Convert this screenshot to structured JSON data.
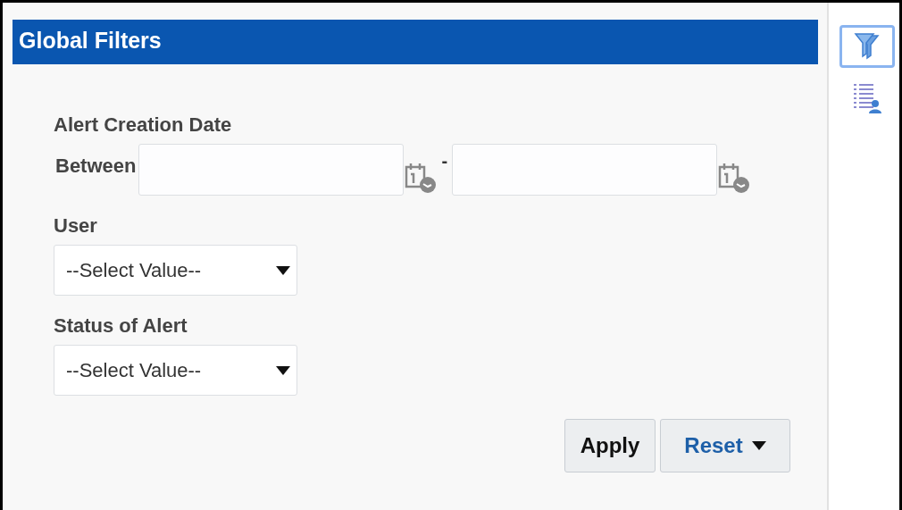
{
  "panel": {
    "title": "Global Filters"
  },
  "filters": [
    {
      "kind": "date_range",
      "label": "Alert Creation Date",
      "prefix": "Between",
      "separator": "-"
    },
    {
      "kind": "select",
      "label": "User",
      "value": "--Select Value--"
    },
    {
      "kind": "select",
      "label": "Status of Alert",
      "value": "--Select Value--"
    }
  ],
  "buttons": [
    {
      "kind": "plain",
      "label": "Apply"
    },
    {
      "kind": "menu",
      "label": "Reset"
    }
  ],
  "side_tools": [
    {
      "kind": "filter",
      "selected": true
    },
    {
      "kind": "list",
      "selected": false
    }
  ]
}
